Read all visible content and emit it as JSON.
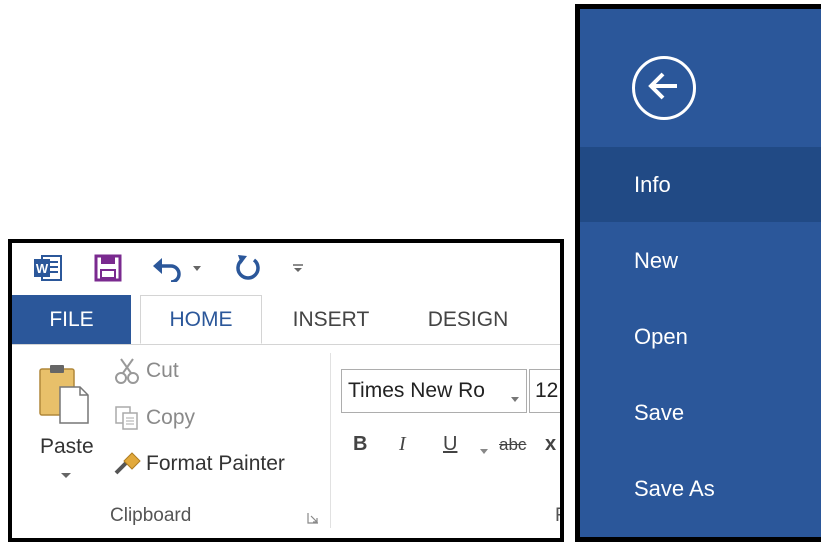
{
  "ribbon": {
    "quick_access": {
      "icons": [
        "word-logo-icon",
        "save-icon",
        "undo-icon",
        "redo-icon",
        "customize-icon"
      ],
      "word_logo_letter": "W"
    },
    "tabs": [
      {
        "label": "FILE"
      },
      {
        "label": "HOME"
      },
      {
        "label": "INSERT"
      },
      {
        "label": "DESIGN"
      }
    ],
    "clipboard": {
      "paste_label": "Paste",
      "cut_label": "Cut",
      "copy_label": "Copy",
      "format_painter_label": "Format Painter",
      "group_label": "Clipboard"
    },
    "font": {
      "font_name": "Times New Ro",
      "font_size": "12",
      "bold": "B",
      "italic": "I",
      "underline": "U",
      "strikethrough": "abc",
      "subscript": "x",
      "group_label_partial": "F"
    },
    "colors": {
      "file_tab": "#2b579a",
      "save_icon": "#7a2a8f",
      "undo_icon": "#2b579a"
    }
  },
  "backstage": {
    "menu": [
      {
        "label": "Info",
        "selected": true
      },
      {
        "label": "New"
      },
      {
        "label": "Open"
      },
      {
        "label": "Save"
      },
      {
        "label": "Save As"
      }
    ],
    "colors": {
      "background": "#2b579a",
      "selected": "#214a85"
    }
  }
}
